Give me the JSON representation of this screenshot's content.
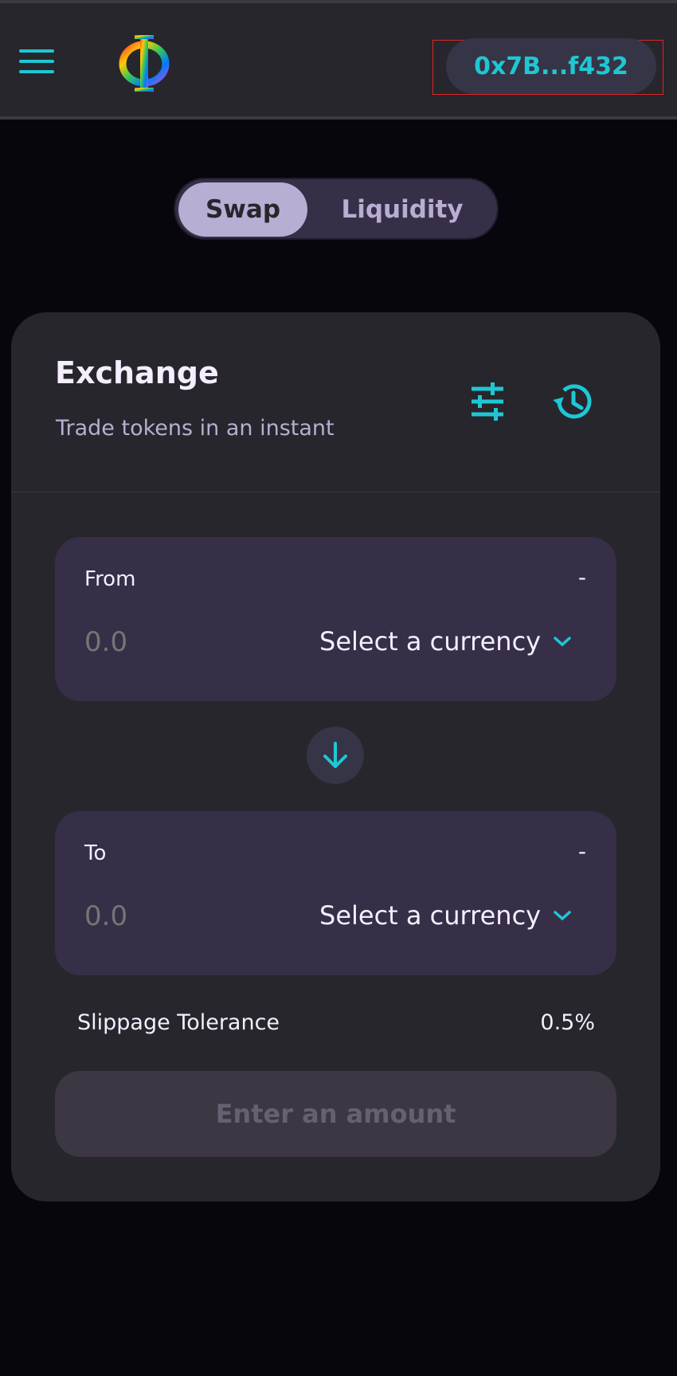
{
  "header": {
    "wallet_address": "0x7B...f432"
  },
  "tabs": {
    "swap_label": "Swap",
    "liquidity_label": "Liquidity",
    "active": "Swap"
  },
  "exchange": {
    "title": "Exchange",
    "subtitle": "Trade tokens in an instant",
    "settings_icon": "settings-sliders-icon",
    "history_icon": "history-clock-icon"
  },
  "from": {
    "label": "From",
    "balance": "-",
    "amount_placeholder": "0.0",
    "currency_label": "Select a currency"
  },
  "to": {
    "label": "To",
    "balance": "-",
    "amount_placeholder": "0.0",
    "currency_label": "Select a currency"
  },
  "slippage": {
    "label": "Slippage Tolerance",
    "value": "0.5%"
  },
  "submit": {
    "label": "Enter an amount"
  },
  "colors": {
    "accent": "#1fc7d4",
    "background": "#08060d",
    "card": "#27262c",
    "panel": "#372f47",
    "secondary_text": "#b8add2"
  }
}
